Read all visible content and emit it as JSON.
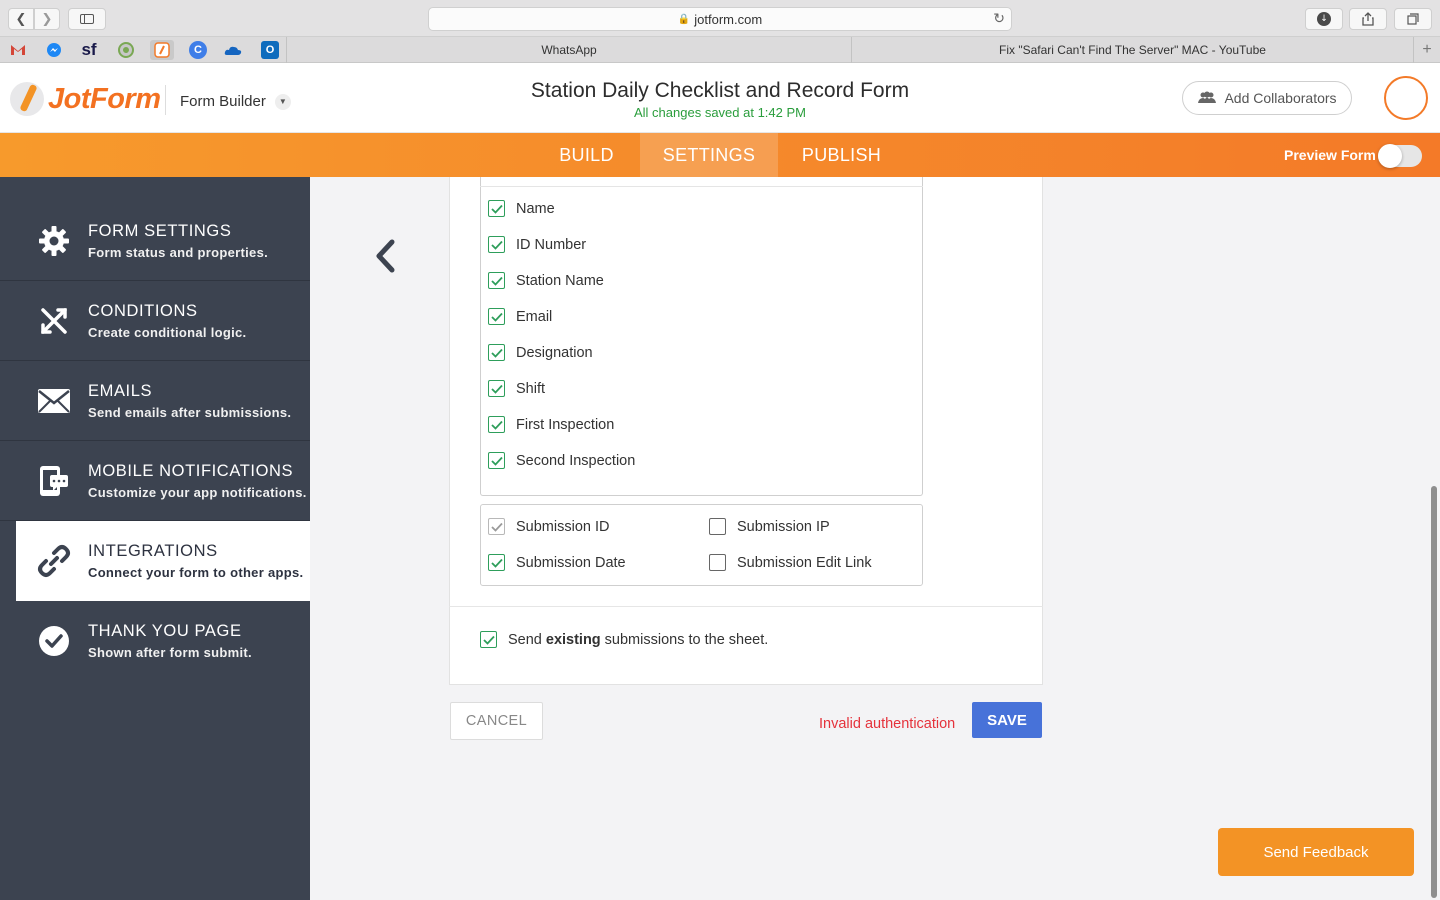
{
  "browser": {
    "url": "jotform.com",
    "tabs": [
      "WhatsApp",
      "Fix \"Safari Can't Find The Server\" MAC - YouTube"
    ],
    "bookmark_icons": [
      "gmail-icon",
      "messenger-icon",
      "salesforce-icon",
      "chrome-web-icon",
      "jotform-bookmark-icon",
      "canva-icon",
      "onedrive-icon",
      "outlook-icon"
    ],
    "bookmark_labels": {
      "salesforce": "sf",
      "canva": "C",
      "outlook": "O"
    }
  },
  "header": {
    "logo_text": "JotForm",
    "form_builder_label": "Form Builder",
    "form_title": "Station Daily Checklist and Record Form",
    "save_status": "All changes saved at 1:42 PM",
    "add_collaborators_label": "Add Collaborators"
  },
  "nav": {
    "tabs": [
      "BUILD",
      "SETTINGS",
      "PUBLISH"
    ],
    "active_tab": "SETTINGS",
    "preview_label": "Preview Form",
    "preview_on": false
  },
  "sidebar": {
    "items": [
      {
        "title": "FORM SETTINGS",
        "desc": "Form status and properties.",
        "icon": "gear-icon"
      },
      {
        "title": "CONDITIONS",
        "desc": "Create conditional logic.",
        "icon": "conditions-icon"
      },
      {
        "title": "EMAILS",
        "desc": "Send emails after submissions.",
        "icon": "envelope-icon"
      },
      {
        "title": "MOBILE NOTIFICATIONS",
        "desc": "Customize your app notifications.",
        "icon": "mobile-icon"
      },
      {
        "title": "INTEGRATIONS",
        "desc": "Connect your form to other apps.",
        "icon": "link-icon"
      },
      {
        "title": "THANK YOU PAGE",
        "desc": "Shown after form submit.",
        "icon": "checkmark-circle-icon"
      }
    ],
    "active": "INTEGRATIONS"
  },
  "fields": [
    {
      "label": "Name",
      "checked": true
    },
    {
      "label": "ID Number",
      "checked": true
    },
    {
      "label": "Station Name",
      "checked": true
    },
    {
      "label": "Email",
      "checked": true
    },
    {
      "label": "Designation",
      "checked": true
    },
    {
      "label": "Shift",
      "checked": true
    },
    {
      "label": "First Inspection",
      "checked": true
    },
    {
      "label": "Second Inspection",
      "checked": true
    }
  ],
  "submission_fields": [
    {
      "label": "Submission ID",
      "checked": true,
      "disabled": true
    },
    {
      "label": "Submission IP",
      "checked": false
    },
    {
      "label": "Submission Date",
      "checked": true
    },
    {
      "label": "Submission Edit Link",
      "checked": false
    }
  ],
  "send_existing": {
    "prefix": "Send",
    "bold": "existing",
    "suffix": "submissions to the sheet.",
    "checked": true
  },
  "actions": {
    "cancel_label": "CANCEL",
    "save_label": "SAVE",
    "error_message": "Invalid authentication"
  },
  "feedback_label": "Send Feedback",
  "colors": {
    "accent_orange": "#f47a28",
    "sidebar_bg": "#3c4350",
    "check_green": "#2e9e5b",
    "save_blue": "#4772d9",
    "error_red": "#e5323b",
    "status_green": "#2a9d3c"
  }
}
